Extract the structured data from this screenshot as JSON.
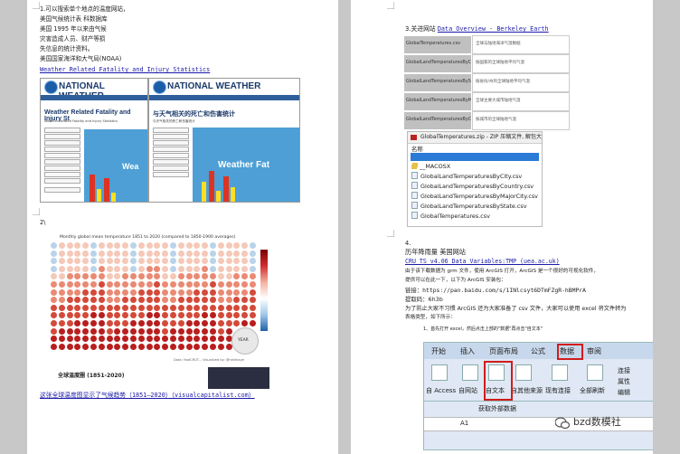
{
  "left_page": {
    "p1_lines": [
      "1.可以搜索单个地点的温度网站，",
      "美国气候统计表 科数据库",
      "美国 1995 年以来由气候",
      "灾害造成人员、财产等损",
      "失信息的统计资料。",
      "美国国家海洋和大气局(NOAA)"
    ],
    "p1_link": "Weather Related Fatality and Injury Statistics",
    "shot1": {
      "org": "NATIONAL WEATHER",
      "title": "Weather Related Fatality and Injury St",
      "subtitle": "Weather Related Fatality and Injury Statistics",
      "chart_text": "Wea"
    },
    "shot2": {
      "title": "与天气相关的死亡和伤害统计",
      "subtitle": "与天气相关的死亡和伤害统计",
      "chart_text": "Weather Fat"
    },
    "p2_label": "2\\",
    "chart_title": "Monthly global mean temperature 1851 to 2020 (compared to 1850-1900 averages)",
    "chart_credit": "Data: HadCRUT...   Visualized by: @neilrkaye",
    "chart_center": "YEAR",
    "bottom_title": "全球温度圈 (1851-2020)",
    "bottom_link": "这张全球温度图显示了气候趋势（1851–2020）（visualcapitalist.com）"
  },
  "right_page": {
    "s3_label": "3.关进网站 ",
    "s3_link": "Data Overview - Berkeley Earth",
    "table": [
      {
        "file": "GlobalTemperatures.csv",
        "desc": "全球与陆地海洋气温数据"
      },
      {
        "file": "GlobalLandTemperaturesByCountry.csv",
        "desc": "按国家的全球陆地平均气温"
      },
      {
        "file": "GlobalLandTemperaturesByState.csv",
        "desc": "按省份/州的全球陆地平均气温"
      },
      {
        "file": "GlobalLandTemperaturesByMajorCity.csv",
        "desc": "全球主要大城市陆地气温"
      },
      {
        "file": "GlobalLandTemperaturesByCity.csv",
        "desc": "按城市的全球陆地气温"
      }
    ],
    "zip": {
      "title": "GlobalTemperatures.zip - ZIP 压缩文件, 解包大",
      "header": "名称",
      "items": [
        "",
        "__MACOSX",
        "GlobalLandTemperaturesByCity.csv",
        "GlobalLandTemperaturesByCountry.csv",
        "GlobalLandTemperaturesByMajorCity.csv",
        "GlobalLandTemperaturesByState.csv",
        "GlobalTemperatures.csv"
      ]
    },
    "s4_label": "4.",
    "s4_line1": "历年降雨量  美国网站",
    "s4_link": "CRU TS v4.06 Data Variables:TMP (uea.ac.uk)",
    "s4_lines": [
      "由于该下载数据为 grm 文件，使用 ArcGIS 打开，ArcGIS 是一个很好的可视化软件，",
      "提供可以在此一下，以下为 ArcGIS 安装包："
    ],
    "s4_netdisk": "链接：https://pan.baidu.com/s/1INlcsyt6DTmFZgR-hBMPrA",
    "s4_code": "提取码：6h3b",
    "s4_note1": "为了防止大家不习惯 ArcGIS 还为大家准备了 csv 文件，大家可以使用 excel 将文件转为",
    "s4_note2": "表格类型，如下所示：",
    "s4_step": "1、首先打开 excel，然后点击上部的\"数据\"再点击\"自文本\"",
    "ribbon": {
      "tabs": [
        "开始",
        "插入",
        "页面布局",
        "公式",
        "数据",
        "审阅"
      ],
      "buttons": [
        "自 Access",
        "自网站",
        "自文本",
        "自其他来源",
        "现有连接",
        "全部刷新"
      ],
      "side": [
        "连接",
        "属性",
        "编辑"
      ],
      "group": "获取外部数据",
      "cell": "A1"
    },
    "watermark": "bzd数模社"
  },
  "colors": {
    "link": "#1a1aa8",
    "excel_red": "#d01c1c",
    "noaa_blue": "#2e5f9a"
  }
}
